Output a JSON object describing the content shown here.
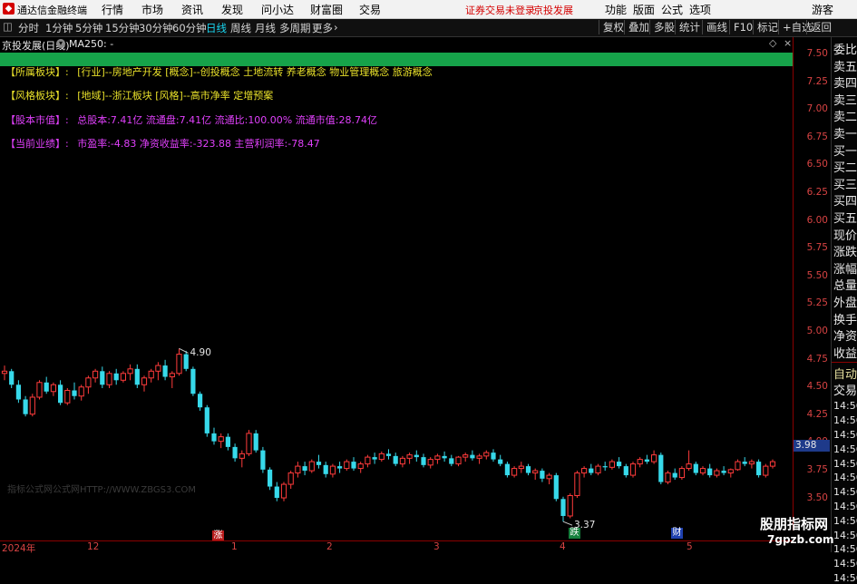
{
  "titlebar": {
    "app_title": "通达信金融终端",
    "menus": [
      "行情",
      "市场",
      "资讯",
      "发现",
      "问小达",
      "财富圈",
      "交易"
    ],
    "warning": "证券交易未登录",
    "stock_name": "京投发展",
    "right_items": [
      "功能",
      "版面",
      "公式",
      "选项"
    ],
    "user": "游客"
  },
  "toolbar": {
    "periods": [
      "分时",
      "1分钟",
      "5分钟",
      "15分钟",
      "30分钟",
      "60分钟",
      "日线",
      "周线",
      "月线",
      "多周期",
      "更多"
    ],
    "active_period": "日线",
    "right_buttons": [
      "复权",
      "叠加",
      "多股",
      "统计",
      "画线",
      "F10",
      "标记",
      "+自选",
      "返回"
    ]
  },
  "chart_header": {
    "title": "京投发展(日线)",
    "indicator": "MA250: -"
  },
  "info_rows": [
    {
      "label": "【所属板块】:",
      "value": "[行业]--房地产开发 [概念]--创投概念 土地流转 养老概念 物业管理概念 旅游概念",
      "color": "yellow"
    },
    {
      "label": "【风格板块】:",
      "value": "[地域]--浙江板块 [风格]--高市净率 定增预案",
      "color": "yellow"
    },
    {
      "label": "【股本市值】:",
      "value": "总股本:7.41亿 流通盘:7.41亿 流通比:100.00% 流通市值:28.74亿",
      "color": "magenta"
    },
    {
      "label": "【当前业绩】:",
      "value": "市盈率:-4.83 净资收益率:-323.88 主营利润率:-78.47",
      "color": "magenta"
    }
  ],
  "y_axis": {
    "ticks": [
      "7.50",
      "7.25",
      "7.00",
      "6.75",
      "6.50",
      "6.25",
      "6.00",
      "5.75",
      "5.50",
      "5.25",
      "5.00",
      "4.75",
      "4.50",
      "4.25",
      "4.00",
      "3.75",
      "3.50"
    ],
    "current_price": "3.98"
  },
  "x_axis": {
    "ticks": [
      "2024年",
      "12",
      "1",
      "2",
      "3",
      "4",
      "5"
    ]
  },
  "annotations": {
    "high": "4.90",
    "low": "3.37",
    "marker_up": "涨",
    "marker_down": "跌",
    "marker_fin": "财"
  },
  "watermark": "指标公式网公式网HTTP://WWW.ZBGS3.COM",
  "right_panel": {
    "labels": [
      "委比",
      "卖五",
      "卖四",
      "卖三",
      "卖二",
      "卖一",
      "买一",
      "买二",
      "买三",
      "买四",
      "买五",
      "现价",
      "涨跌",
      "涨幅",
      "总量",
      "外盘",
      "换手",
      "净资",
      "收益"
    ],
    "tab_active": "自动",
    "tab_other": "交易",
    "times": [
      "14:56",
      "14:56",
      "14:56",
      "14:56",
      "14:56",
      "14:56",
      "14:56",
      "14:56",
      "14:56",
      "14:56",
      "14:56",
      "14:56",
      "14:56"
    ]
  },
  "brand": {
    "name": "股朋指标网",
    "url": "7gpzb.com"
  },
  "colors": {
    "up": "#ff3b3b",
    "down": "#37d9ea",
    "axis": "#d84343",
    "green_bar": "#16a34a"
  },
  "chart_data": {
    "type": "candlestick",
    "y_range": [
      3.45,
      7.6
    ],
    "candles": [
      [
        4.68,
        4.75,
        4.62,
        4.7
      ],
      [
        4.7,
        4.72,
        4.55,
        4.58
      ],
      [
        4.58,
        4.62,
        4.42,
        4.45
      ],
      [
        4.45,
        4.48,
        4.3,
        4.32
      ],
      [
        4.32,
        4.5,
        4.3,
        4.47
      ],
      [
        4.47,
        4.62,
        4.45,
        4.6
      ],
      [
        4.6,
        4.65,
        4.5,
        4.52
      ],
      [
        4.52,
        4.6,
        4.48,
        4.58
      ],
      [
        4.58,
        4.62,
        4.4,
        4.42
      ],
      [
        4.42,
        4.55,
        4.4,
        4.53
      ],
      [
        4.53,
        4.6,
        4.45,
        4.48
      ],
      [
        4.48,
        4.58,
        4.44,
        4.56
      ],
      [
        4.56,
        4.66,
        4.5,
        4.64
      ],
      [
        4.64,
        4.72,
        4.6,
        4.7
      ],
      [
        4.7,
        4.74,
        4.55,
        4.58
      ],
      [
        4.58,
        4.7,
        4.55,
        4.68
      ],
      [
        4.68,
        4.72,
        4.58,
        4.62
      ],
      [
        4.62,
        4.7,
        4.6,
        4.68
      ],
      [
        4.68,
        4.76,
        4.62,
        4.72
      ],
      [
        4.72,
        4.76,
        4.55,
        4.58
      ],
      [
        4.58,
        4.66,
        4.52,
        4.64
      ],
      [
        4.64,
        4.72,
        4.6,
        4.7
      ],
      [
        4.7,
        4.78,
        4.62,
        4.75
      ],
      [
        4.75,
        4.8,
        4.62,
        4.65
      ],
      [
        4.65,
        4.7,
        4.55,
        4.68
      ],
      [
        4.68,
        4.9,
        4.66,
        4.85
      ],
      [
        4.85,
        4.88,
        4.7,
        4.72
      ],
      [
        4.72,
        4.74,
        4.48,
        4.5
      ],
      [
        4.5,
        4.52,
        4.35,
        4.38
      ],
      [
        4.38,
        4.4,
        4.12,
        4.15
      ],
      [
        4.15,
        4.2,
        4.05,
        4.08
      ],
      [
        4.08,
        4.15,
        4.02,
        4.12
      ],
      [
        4.12,
        4.15,
        4.0,
        4.03
      ],
      [
        4.03,
        4.06,
        3.9,
        3.93
      ],
      [
        3.93,
        4.0,
        3.85,
        3.97
      ],
      [
        3.97,
        4.18,
        3.95,
        4.15
      ],
      [
        4.15,
        4.18,
        3.98,
        4.0
      ],
      [
        4.0,
        4.03,
        3.8,
        3.83
      ],
      [
        3.83,
        3.85,
        3.65,
        3.68
      ],
      [
        3.68,
        3.72,
        3.55,
        3.58
      ],
      [
        3.58,
        3.72,
        3.55,
        3.7
      ],
      [
        3.7,
        3.82,
        3.66,
        3.8
      ],
      [
        3.8,
        3.9,
        3.76,
        3.86
      ],
      [
        3.86,
        3.9,
        3.78,
        3.82
      ],
      [
        3.82,
        3.92,
        3.8,
        3.9
      ],
      [
        3.9,
        3.96,
        3.84,
        3.87
      ],
      [
        3.87,
        3.9,
        3.76,
        3.79
      ],
      [
        3.79,
        3.88,
        3.76,
        3.86
      ],
      [
        3.86,
        3.9,
        3.8,
        3.84
      ],
      [
        3.84,
        3.92,
        3.82,
        3.9
      ],
      [
        3.9,
        3.94,
        3.82,
        3.84
      ],
      [
        3.84,
        3.9,
        3.8,
        3.88
      ],
      [
        3.88,
        3.96,
        3.85,
        3.94
      ],
      [
        3.94,
        3.98,
        3.88,
        3.92
      ],
      [
        3.92,
        3.99,
        3.9,
        3.97
      ],
      [
        3.97,
        4.01,
        3.92,
        3.95
      ],
      [
        3.95,
        3.98,
        3.86,
        3.88
      ],
      [
        3.88,
        3.95,
        3.85,
        3.93
      ],
      [
        3.93,
        3.98,
        3.88,
        3.96
      ],
      [
        3.96,
        4.0,
        3.9,
        3.94
      ],
      [
        3.94,
        3.97,
        3.85,
        3.87
      ],
      [
        3.87,
        3.94,
        3.84,
        3.92
      ],
      [
        3.92,
        3.97,
        3.88,
        3.95
      ],
      [
        3.95,
        3.99,
        3.9,
        3.93
      ],
      [
        3.93,
        3.96,
        3.86,
        3.88
      ],
      [
        3.88,
        3.95,
        3.86,
        3.94
      ],
      [
        3.94,
        3.98,
        3.9,
        3.96
      ],
      [
        3.96,
        4.0,
        3.91,
        3.93
      ],
      [
        3.93,
        3.97,
        3.88,
        3.95
      ],
      [
        3.95,
        4.0,
        3.92,
        3.98
      ],
      [
        3.98,
        4.01,
        3.9,
        3.92
      ],
      [
        3.92,
        3.96,
        3.86,
        3.88
      ],
      [
        3.88,
        3.9,
        3.76,
        3.78
      ],
      [
        3.78,
        3.86,
        3.76,
        3.84
      ],
      [
        3.84,
        3.9,
        3.8,
        3.86
      ],
      [
        3.86,
        3.88,
        3.78,
        3.8
      ],
      [
        3.8,
        3.84,
        3.74,
        3.82
      ],
      [
        3.82,
        3.84,
        3.72,
        3.75
      ],
      [
        3.75,
        3.8,
        3.7,
        3.78
      ],
      [
        3.78,
        3.8,
        3.55,
        3.57
      ],
      [
        3.57,
        3.59,
        3.37,
        3.42
      ],
      [
        3.42,
        3.62,
        3.4,
        3.6
      ],
      [
        3.6,
        3.82,
        3.58,
        3.8
      ],
      [
        3.8,
        3.86,
        3.76,
        3.84
      ],
      [
        3.84,
        3.88,
        3.78,
        3.8
      ],
      [
        3.8,
        3.88,
        3.78,
        3.86
      ],
      [
        3.86,
        3.9,
        3.82,
        3.85
      ],
      [
        3.85,
        3.92,
        3.83,
        3.9
      ],
      [
        3.9,
        3.94,
        3.84,
        3.86
      ],
      [
        3.86,
        3.88,
        3.76,
        3.78
      ],
      [
        3.78,
        3.9,
        3.76,
        3.88
      ],
      [
        3.88,
        3.94,
        3.85,
        3.92
      ],
      [
        3.92,
        3.96,
        3.88,
        3.9
      ],
      [
        3.9,
        4.0,
        3.88,
        3.96
      ],
      [
        3.96,
        3.98,
        3.7,
        3.72
      ],
      [
        3.72,
        3.82,
        3.7,
        3.8
      ],
      [
        3.8,
        3.84,
        3.74,
        3.76
      ],
      [
        3.76,
        3.86,
        3.74,
        3.84
      ],
      [
        3.84,
        4.0,
        3.82,
        3.88
      ],
      [
        3.88,
        3.9,
        3.78,
        3.8
      ],
      [
        3.8,
        3.86,
        3.78,
        3.84
      ],
      [
        3.84,
        3.88,
        3.76,
        3.78
      ],
      [
        3.78,
        3.84,
        3.76,
        3.82
      ],
      [
        3.82,
        3.86,
        3.78,
        3.8
      ],
      [
        3.8,
        3.84,
        3.76,
        3.83
      ],
      [
        3.83,
        3.92,
        3.82,
        3.9
      ],
      [
        3.9,
        3.94,
        3.86,
        3.88
      ],
      [
        3.88,
        3.92,
        3.84,
        3.9
      ],
      [
        3.9,
        3.92,
        3.76,
        3.78
      ],
      [
        3.78,
        3.88,
        3.76,
        3.86
      ],
      [
        3.86,
        3.92,
        3.84,
        3.9
      ]
    ]
  }
}
